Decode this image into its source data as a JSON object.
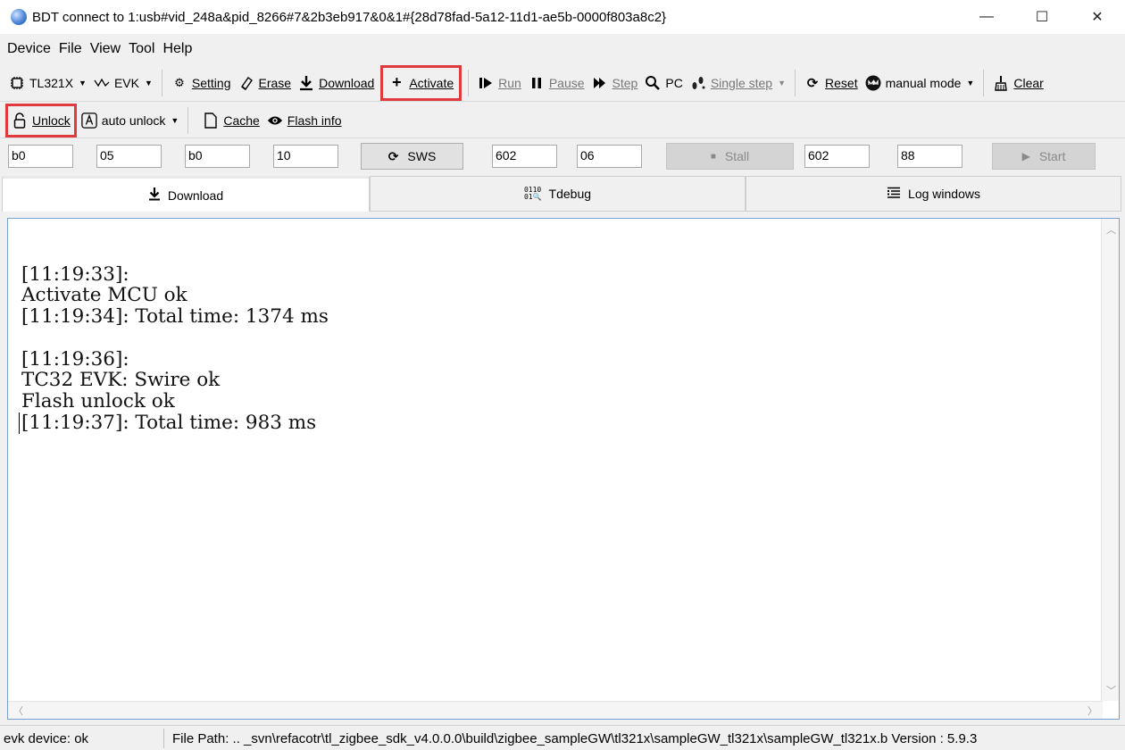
{
  "window": {
    "title": "BDT connect to 1:usb#vid_248a&pid_8266#7&2b3eb917&0&1#{28d78fad-5a12-11d1-ae5b-0000f803a8c2}",
    "controls": {
      "minimize": "—",
      "maximize": "☐",
      "close": "✕"
    }
  },
  "menu": [
    "Device",
    "File",
    "View",
    "Tool",
    "Help"
  ],
  "toolbar1": {
    "chip": "TL321X",
    "evk": "EVK",
    "setting": "Setting",
    "erase": "Erase",
    "download": "Download",
    "activate": "Activate",
    "run": "Run",
    "pause": "Pause",
    "step": "Step",
    "pc": "PC",
    "single_step": "Single step",
    "reset": "Reset",
    "manual_mode": "manual mode",
    "clear": "Clear"
  },
  "toolbar2": {
    "unlock": "Unlock",
    "auto_unlock": "auto unlock",
    "cache": "Cache",
    "flash_info": "Flash info"
  },
  "fields": {
    "f1": "b0",
    "f2": "05",
    "f3": "b0",
    "f4": "10",
    "sws": "SWS",
    "f5": "602",
    "f6": "06",
    "stall": "Stall",
    "f7": "602",
    "f8": "88",
    "start": "Start"
  },
  "tabs": [
    "Download",
    "Tdebug",
    "Log windows"
  ],
  "log": {
    "lines": [
      "",
      "[11:19:33]:",
      "Activate MCU ok",
      "[11:19:34]: Total time: 1374 ms",
      "",
      "[11:19:36]:",
      "TC32 EVK: Swire ok",
      "Flash unlock ok",
      "[11:19:37]: Total time: 983 ms"
    ]
  },
  "status": {
    "device": "evk device: ok",
    "file_path": "File Path:  .. _svn\\refacotr\\tl_zigbee_sdk_v4.0.0.0\\build\\zigbee_sampleGW\\tl321x\\sampleGW_tl321x\\sampleGW_tl321x.b Version : 5.9.3"
  },
  "highlight_color": "#e0393e"
}
